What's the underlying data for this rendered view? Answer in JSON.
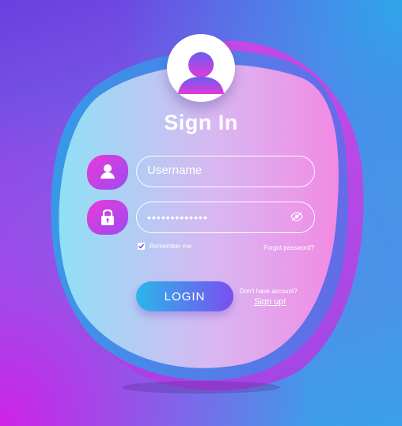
{
  "title": "Sign In",
  "username": {
    "placeholder": "Username",
    "icon": "user-icon"
  },
  "password": {
    "masked_value": "•••••••••••••",
    "icon": "lock-icon",
    "toggle_icon": "eye-slash-icon"
  },
  "remember": {
    "label": "Remember me",
    "checked": true
  },
  "forgot_label": "Forgot password?",
  "login_label": "LOGIN",
  "signup": {
    "prompt": "Don't have account?",
    "link_label": "Sign up!"
  },
  "colors": {
    "accent_pink": "#e93ad8",
    "accent_purple": "#9d4af0",
    "accent_blue": "#2ab6ea",
    "background_purple": "#6a3fe0",
    "background_magenta": "#d61ce8"
  }
}
